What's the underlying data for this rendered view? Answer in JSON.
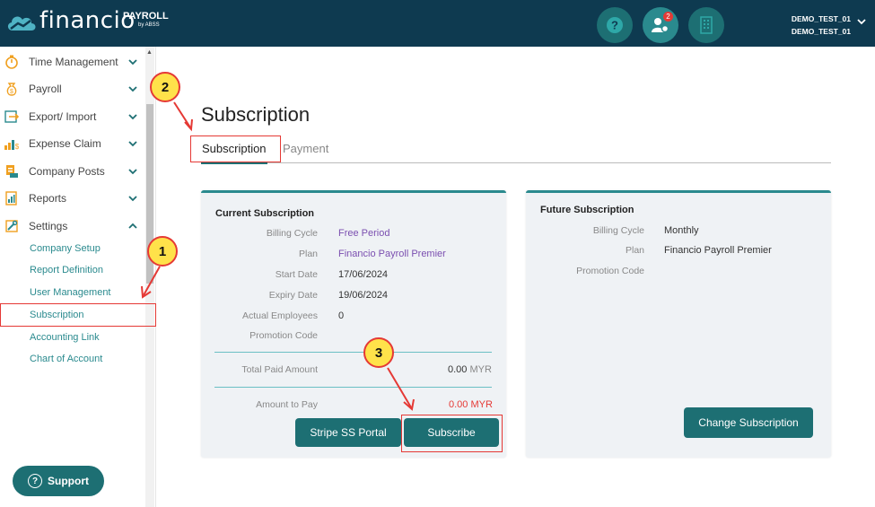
{
  "app": {
    "logo_text": "financio",
    "product": "PAYROLL",
    "vendor": "by ABSS",
    "user_line1": "DEMO_TEST_01",
    "user_line2": "DEMO_TEST_01",
    "notification_count": "2"
  },
  "sidebar": {
    "items": [
      {
        "label": "Time Management",
        "icon": "stopwatch-icon"
      },
      {
        "label": "Payroll",
        "icon": "money-bag-icon"
      },
      {
        "label": "Export/ Import",
        "icon": "export-import-icon"
      },
      {
        "label": "Expense Claim",
        "icon": "expense-icon"
      },
      {
        "label": "Company Posts",
        "icon": "company-posts-icon"
      },
      {
        "label": "Reports",
        "icon": "reports-icon"
      },
      {
        "label": "Settings",
        "icon": "settings-icon"
      }
    ],
    "settings_sub": [
      "Company Setup",
      "Report Definition",
      "User Management",
      "Subscription",
      "Accounting Link",
      "Chart of Account"
    ],
    "support_label": "Support"
  },
  "main": {
    "title": "Subscription",
    "tabs": [
      "Subscription",
      "Payment"
    ]
  },
  "current": {
    "title": "Current Subscription",
    "billing_cycle_label": "Billing Cycle",
    "billing_cycle": "Free Period",
    "plan_label": "Plan",
    "plan": "Financio Payroll Premier",
    "start_label": "Start Date",
    "start": "17/06/2024",
    "expiry_label": "Expiry Date",
    "expiry": "19/06/2024",
    "employees_label": "Actual Employees",
    "employees": "0",
    "promo_label": "Promotion Code",
    "total_paid_label": "Total Paid Amount",
    "total_paid": "0.00",
    "currency": "MYR",
    "to_pay_label": "Amount to Pay",
    "to_pay": "0.00 MYR",
    "portal_button": "Stripe SS Portal",
    "subscribe_button": "Subscribe"
  },
  "future": {
    "title": "Future Subscription",
    "billing_cycle_label": "Billing Cycle",
    "billing_cycle": "Monthly",
    "plan_label": "Plan",
    "plan": "Financio Payroll Premier",
    "promo_label": "Promotion Code",
    "change_button": "Change Subscription"
  },
  "callouts": [
    "1",
    "2",
    "3"
  ],
  "colors": {
    "header": "#0e3a50",
    "accent": "#1d6f73",
    "highlight": "#e53935",
    "callout": "#ffe24a"
  }
}
